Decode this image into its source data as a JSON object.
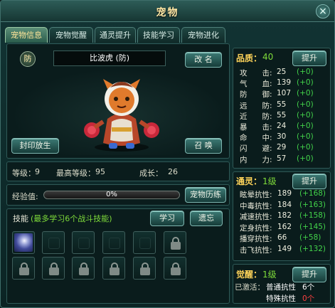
{
  "window": {
    "title": "宠物"
  },
  "tabs": [
    {
      "label": "宠物信息",
      "active": true
    },
    {
      "label": "宠物觉醒",
      "active": false
    },
    {
      "label": "通灵提升",
      "active": false
    },
    {
      "label": "技能学习",
      "active": false
    },
    {
      "label": "宠物进化",
      "active": false
    }
  ],
  "pet": {
    "type_badge": "防",
    "name": "比波虎 (防)",
    "rename_label": "改 名",
    "release_label": "封印放生",
    "summon_label": "召 唤",
    "level_label": "等级：",
    "level": "9",
    "max_level_label": "最高等级：",
    "max_level": "95",
    "growth_label": "成长：",
    "growth": "26",
    "exp_label": "经验值:",
    "exp_text": "0%",
    "exp_fraction": 0.0,
    "history_label": "宠物历练"
  },
  "skills": {
    "label": "技能",
    "hint": "(最多学习6个战斗技能)",
    "learn_label": "学习",
    "forget_label": "遗忘"
  },
  "quality": {
    "label": "品质：",
    "value": "40",
    "upgrade_label": "提升",
    "stats": [
      {
        "label": "攻　　击:",
        "value": "25",
        "bonus": "(+0)"
      },
      {
        "label": "气　　血:",
        "value": "139",
        "bonus": "(+0)"
      },
      {
        "label": "防　　御:",
        "value": "107",
        "bonus": "(+0)"
      },
      {
        "label": "远　　防:",
        "value": "55",
        "bonus": "(+0)"
      },
      {
        "label": "近　　防:",
        "value": "55",
        "bonus": "(+0)"
      },
      {
        "label": "暴　　击:",
        "value": "24",
        "bonus": "(+0)"
      },
      {
        "label": "命　　中:",
        "value": "30",
        "bonus": "(+0)"
      },
      {
        "label": "闪　　避:",
        "value": "29",
        "bonus": "(+0)"
      },
      {
        "label": "内　　力:",
        "value": "57",
        "bonus": "(+0)"
      }
    ]
  },
  "spirit": {
    "label": "通灵：",
    "value": "1级",
    "upgrade_label": "提升",
    "stats": [
      {
        "label": "眩晕抗性:",
        "value": "189",
        "bonus": "(+168)"
      },
      {
        "label": "中毒抗性:",
        "value": "184",
        "bonus": "(+163)"
      },
      {
        "label": "减速抗性:",
        "value": "182",
        "bonus": "(+158)"
      },
      {
        "label": "定身抗性:",
        "value": "162",
        "bonus": "(+145)"
      },
      {
        "label": "播穿抗性:",
        "value": "66",
        "bonus": "(+58)"
      },
      {
        "label": "击飞抗性:",
        "value": "149",
        "bonus": "(+132)"
      }
    ]
  },
  "awaken": {
    "label": "觉醒：",
    "value": "1级",
    "upgrade_label": "提升",
    "activated_label": "已激活：",
    "normal_label": "普通抗性",
    "normal_count": "6个",
    "special_label": "特殊抗性",
    "special_count": "0个"
  },
  "colors": {
    "accent_green": "#7fdc3a",
    "bonus_green": "#42d24a",
    "gold": "#ffd45a",
    "warning_red": "#ff4040"
  }
}
